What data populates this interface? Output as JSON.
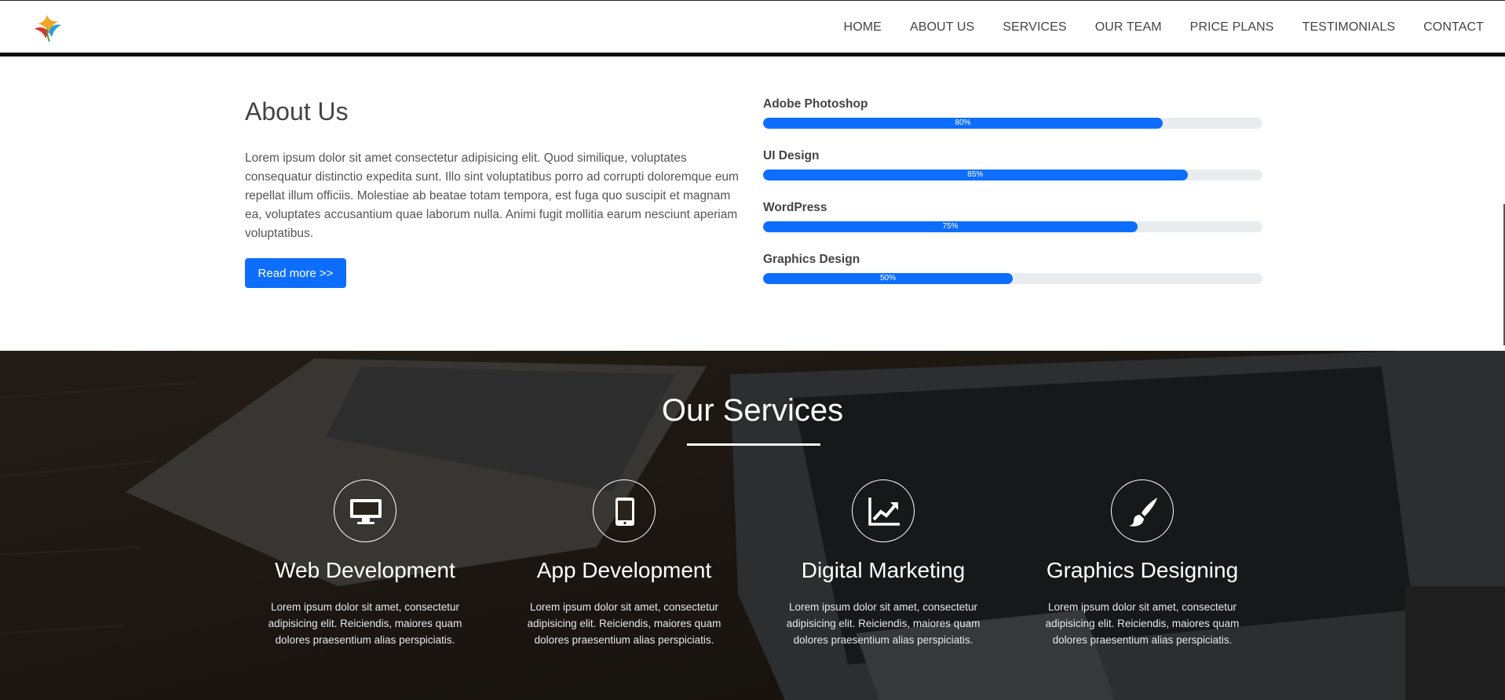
{
  "navbar": {
    "links": [
      "HOME",
      "ABOUT US",
      "SERVICES",
      "OUR TEAM",
      "PRICE PLANS",
      "TESTIMONIALS",
      "CONTACT"
    ]
  },
  "about": {
    "title": "About Us",
    "text": "Lorem ipsum dolor sit amet consectetur adipisicing elit. Quod similique, voluptates consequatur distinctio expedita sunt. Illo sint voluptatibus porro ad corrupti doloremque eum repellat illum officiis. Molestiae ab beatae totam tempora, est fuga quo suscipit et magnam ea, voluptates accusantium quae laborum nulla. Animi fugit mollitia earum nesciunt aperiam voluptatibus.",
    "read_more_label": "Read more >>",
    "skills": [
      {
        "name": "Adobe Photoshop",
        "percent": 80,
        "percent_label": "80%"
      },
      {
        "name": "UI Design",
        "percent": 85,
        "percent_label": "85%"
      },
      {
        "name": "WordPress",
        "percent": 75,
        "percent_label": "75%"
      },
      {
        "name": "Graphics Design",
        "percent": 50,
        "percent_label": "50%"
      }
    ]
  },
  "services": {
    "title": "Our Services",
    "items": [
      {
        "title": "Web Development",
        "icon": "monitor-icon",
        "text": "Lorem ipsum dolor sit amet, consectetur adipisicing elit. Reiciendis, maiores quam dolores praesentium alias perspiciatis."
      },
      {
        "title": "App Development",
        "icon": "tablet-icon",
        "text": "Lorem ipsum dolor sit amet, consectetur adipisicing elit. Reiciendis, maiores quam dolores praesentium alias perspiciatis."
      },
      {
        "title": "Digital Marketing",
        "icon": "chart-line-icon",
        "text": "Lorem ipsum dolor sit amet, consectetur adipisicing elit. Reiciendis, maiores quam dolores praesentium alias perspiciatis."
      },
      {
        "title": "Graphics Designing",
        "icon": "paint-brush-icon",
        "text": "Lorem ipsum dolor sit amet, consectetur adipisicing elit. Reiciendis, maiores quam dolores praesentium alias perspiciatis."
      }
    ]
  },
  "colors": {
    "accent": "#0d6efd",
    "bar_track": "#e9ecef",
    "services_bg": "#2a231c"
  }
}
